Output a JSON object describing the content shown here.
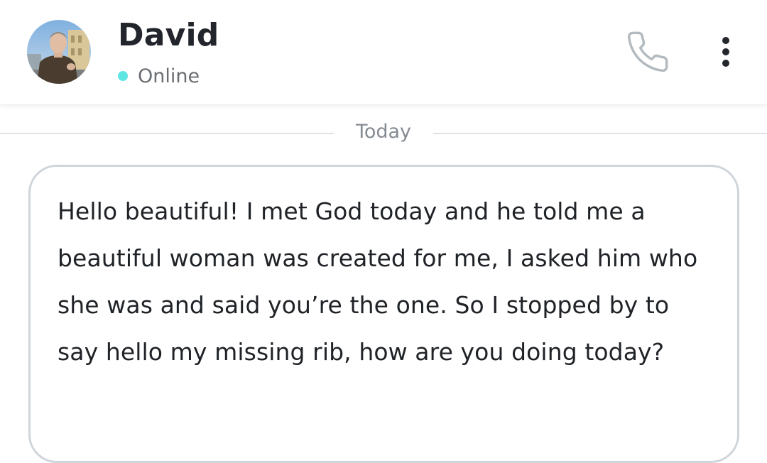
{
  "contact": {
    "name": "David",
    "status": "Online",
    "status_color": "#5ee6e3",
    "avatar_icon": "contact-avatar-photo"
  },
  "header_actions": {
    "call_icon": "phone-icon",
    "menu_icon": "more-vertical-icon"
  },
  "chat": {
    "date_label": "Today",
    "messages": [
      {
        "text": "Hello beautiful! I met God today and he told me a beautiful woman was created for me, I asked him who she was and said you’re the one. So I stopped by to say hello my missing rib, how are you doing today?",
        "direction": "incoming"
      }
    ]
  }
}
